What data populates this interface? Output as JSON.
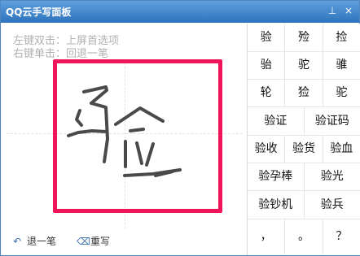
{
  "title": "QQ云手写面板",
  "hints": [
    "左键双击：上屏首选项",
    "右键单击：回退一笔"
  ],
  "actions": {
    "undo": "退一笔",
    "rewrite": "重写"
  },
  "candidates": [
    [
      "验",
      "殓",
      "捡"
    ],
    [
      "骀",
      "驼",
      "骓"
    ],
    [
      "轮",
      "猃",
      "驼"
    ],
    [
      "验证",
      "验证码"
    ],
    [
      "验收",
      "验货",
      "验血"
    ],
    [
      "验孕棒",
      "验光"
    ],
    [
      "验钞机",
      "验兵"
    ],
    [
      "，",
      "。",
      "？"
    ]
  ],
  "icons": {
    "pin": "pin-icon",
    "close": "close-icon",
    "undo": "undo-icon",
    "eraser": "eraser-icon"
  },
  "colors": {
    "titlebar": "#2d73bd",
    "frame": "#f0145a"
  }
}
